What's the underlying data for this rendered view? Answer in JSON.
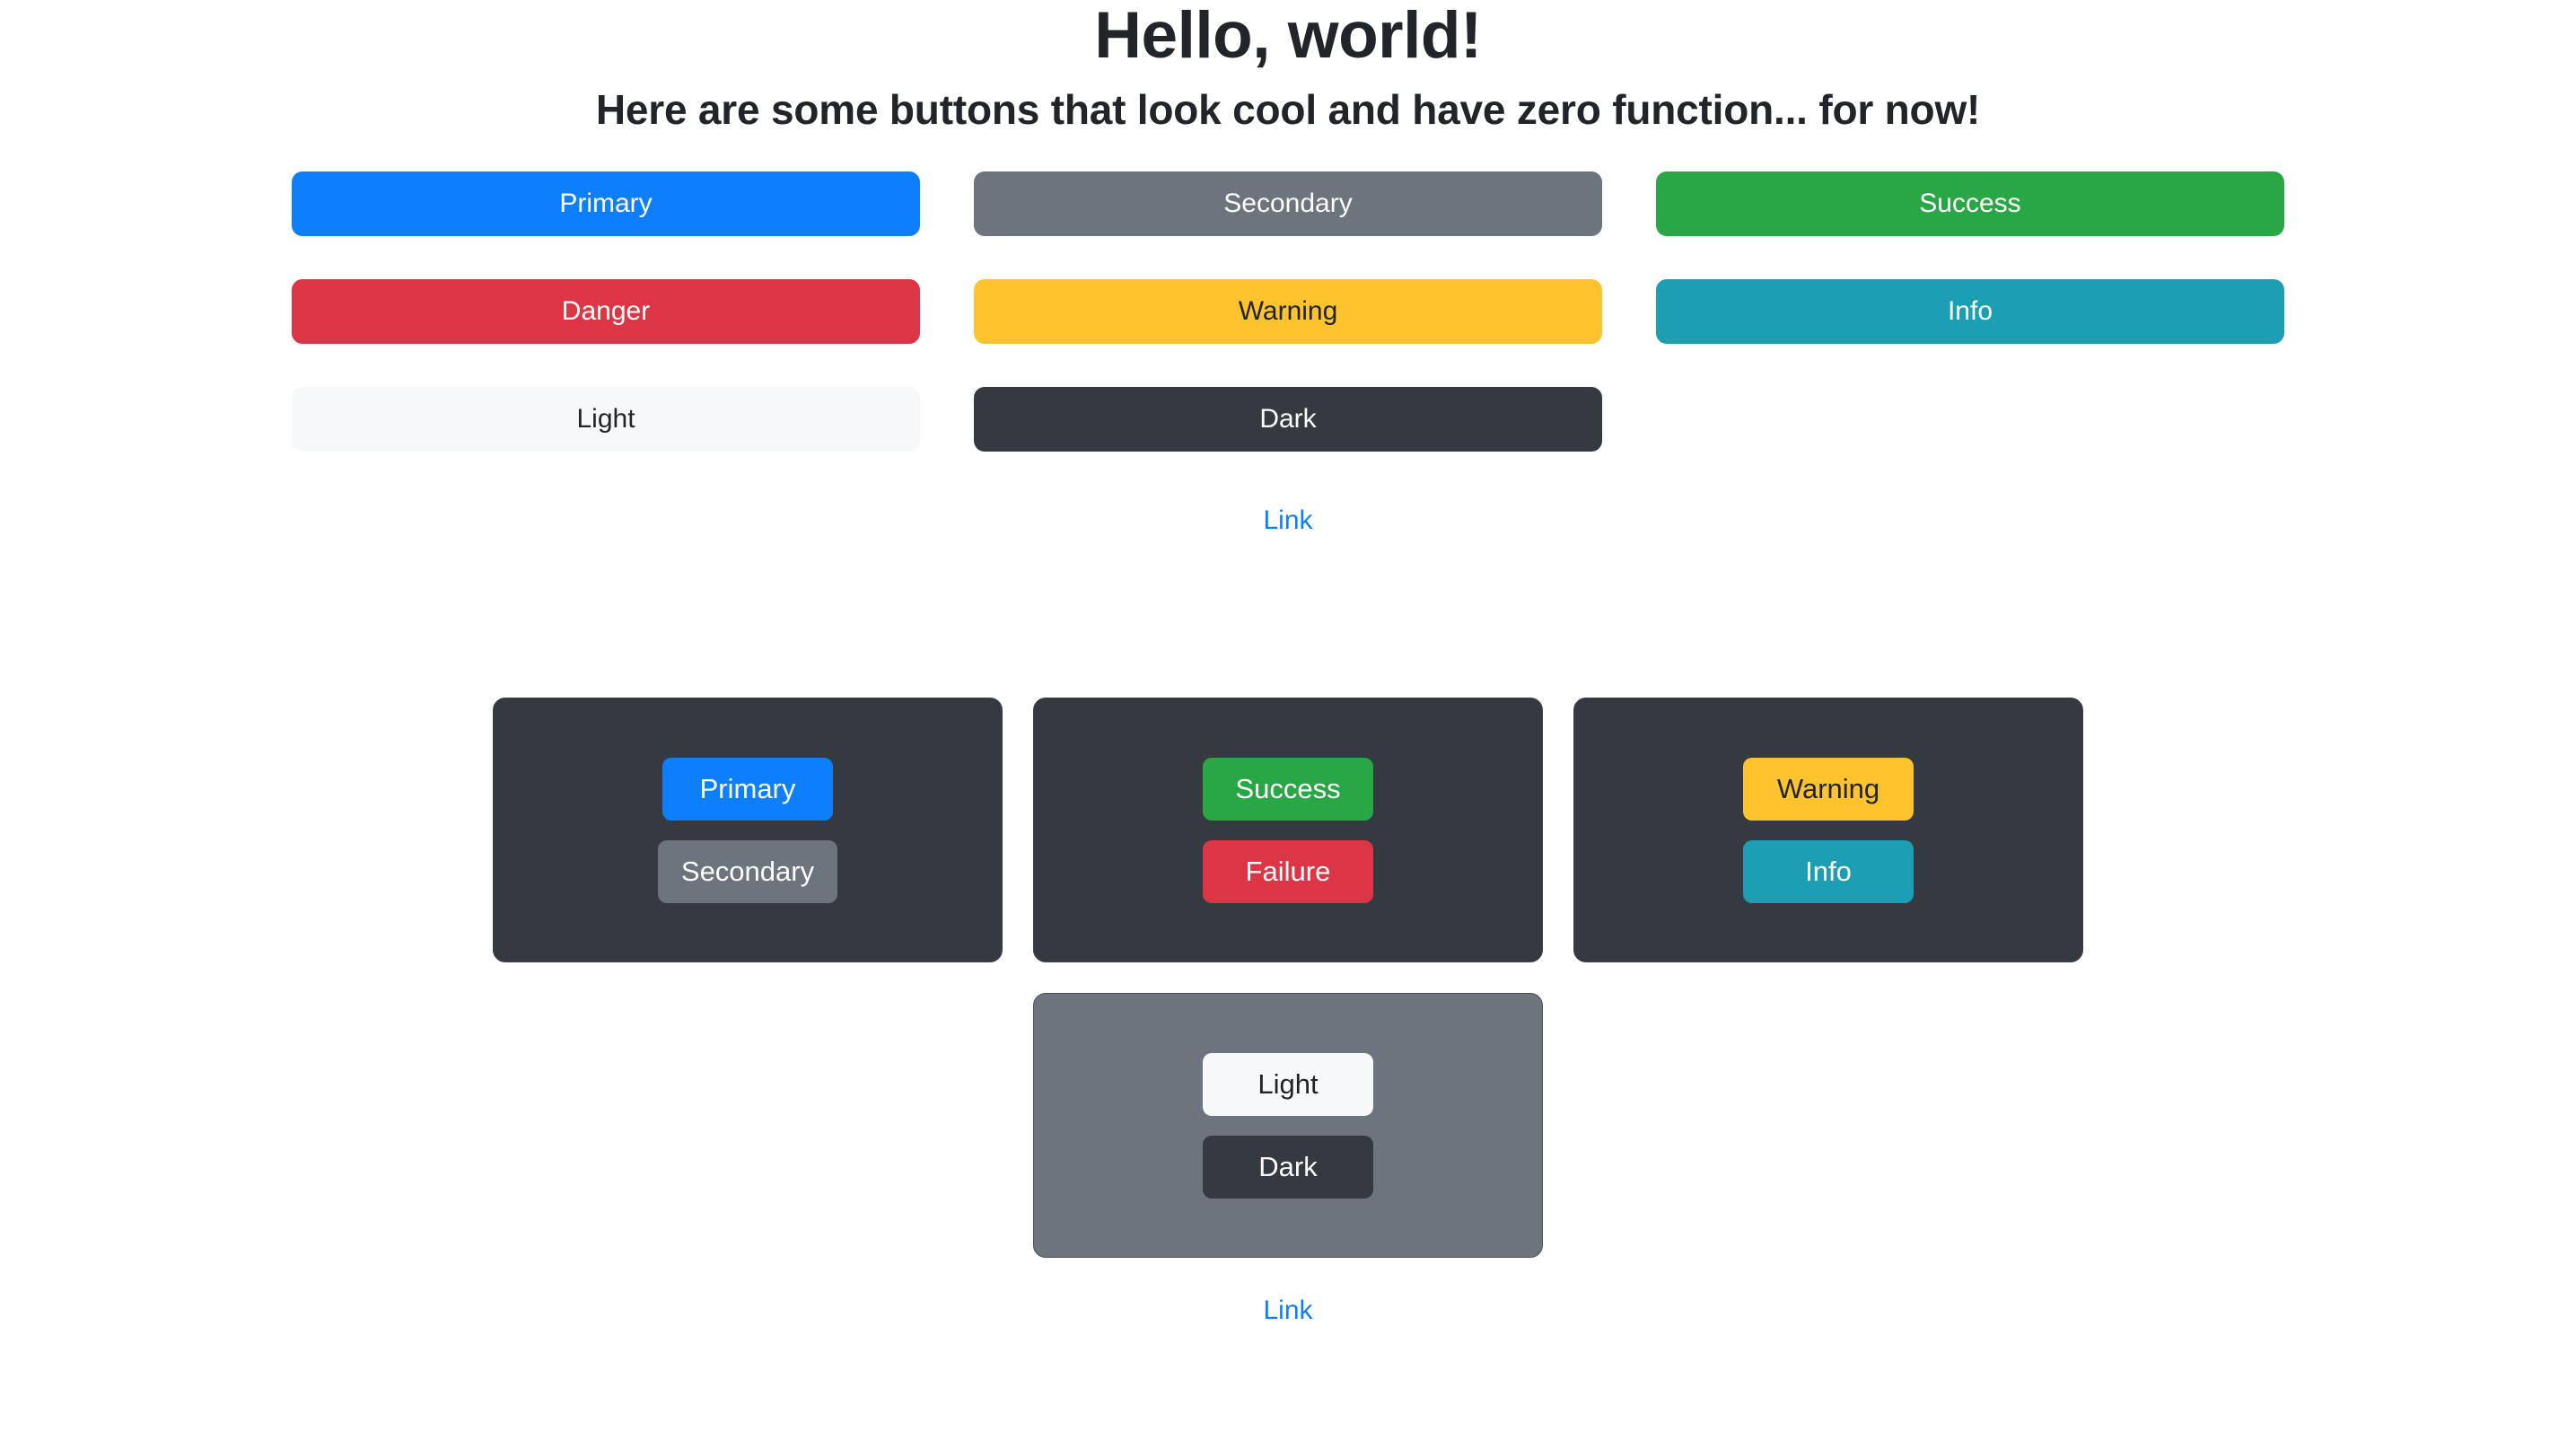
{
  "header": {
    "title": "Hello, world!",
    "subtitle": "Here are some buttons that look cool and have zero function... for now!"
  },
  "colors": {
    "primary": "#0d7ffc",
    "secondary": "#6c757d",
    "success": "#29a745",
    "danger": "#dc3546",
    "warning": "#ffc32d",
    "info": "#1c9fb3",
    "light": "#f7f8fa",
    "dark": "#343a40",
    "link": "#0d7ffc",
    "text_on_dark": "#ffffff",
    "text_on_light": "#212529"
  },
  "button_grid": {
    "buttons": [
      {
        "label": "Primary",
        "variant": "primary",
        "bg": "#0d7ffc",
        "fg": "#ffffff"
      },
      {
        "label": "Secondary",
        "variant": "secondary",
        "bg": "#6c757d",
        "fg": "#ffffff"
      },
      {
        "label": "Success",
        "variant": "success",
        "bg": "#29a745",
        "fg": "#ffffff"
      },
      {
        "label": "Danger",
        "variant": "danger",
        "bg": "#dc3546",
        "fg": "#ffffff"
      },
      {
        "label": "Warning",
        "variant": "warning",
        "bg": "#ffc32d",
        "fg": "#212529"
      },
      {
        "label": "Info",
        "variant": "info",
        "bg": "#1c9fb3",
        "fg": "#ffffff"
      },
      {
        "label": "Light",
        "variant": "light",
        "bg": "#f7f8fa",
        "fg": "#212529"
      },
      {
        "label": "Dark",
        "variant": "dark",
        "bg": "#343a40",
        "fg": "#ffffff"
      }
    ]
  },
  "top_link": {
    "label": "Link"
  },
  "bottom_link": {
    "label": "Link"
  },
  "cards": [
    {
      "theme": "dark",
      "bg": "#343a40",
      "buttons": [
        {
          "label": "Primary",
          "bg": "#0d7ffc",
          "fg": "#ffffff"
        },
        {
          "label": "Secondary",
          "bg": "#6c757d",
          "fg": "#ffffff"
        }
      ]
    },
    {
      "theme": "dark",
      "bg": "#343a40",
      "buttons": [
        {
          "label": "Success",
          "bg": "#29a745",
          "fg": "#ffffff"
        },
        {
          "label": "Failure",
          "bg": "#dc3546",
          "fg": "#ffffff"
        }
      ]
    },
    {
      "theme": "dark",
      "bg": "#343a40",
      "buttons": [
        {
          "label": "Warning",
          "bg": "#ffc32d",
          "fg": "#212529"
        },
        {
          "label": "Info",
          "bg": "#1c9fb3",
          "fg": "#ffffff"
        }
      ]
    },
    {
      "theme": "gray",
      "bg": "#6c757d",
      "buttons": [
        {
          "label": "Light",
          "bg": "#f7f8fa",
          "fg": "#212529"
        },
        {
          "label": "Dark",
          "bg": "#343a40",
          "fg": "#ffffff"
        }
      ]
    }
  ]
}
